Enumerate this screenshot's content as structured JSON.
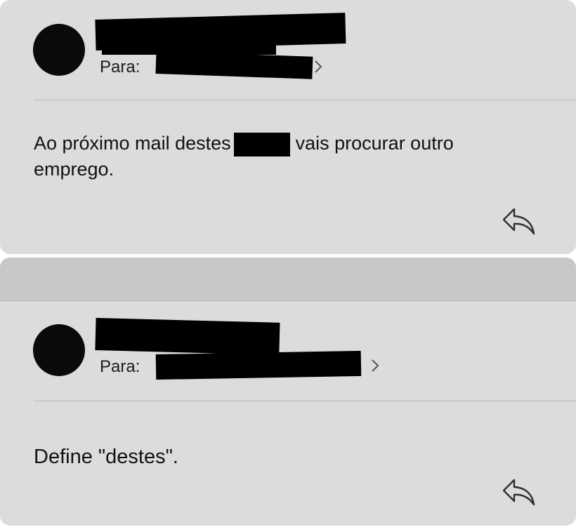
{
  "messages": [
    {
      "to_label": "Para:",
      "body_before": "Ao próximo mail destes",
      "body_after": "vais procurar outro",
      "body_line2": "emprego."
    },
    {
      "to_label": "Para:",
      "body": "Define \"destes\"."
    }
  ],
  "icons": {
    "avatar": "avatar",
    "chevron": "chevron-right-icon",
    "reply": "reply-icon"
  },
  "colors": {
    "card_background": "#dcdcdc",
    "separator_bar": "#c8c8c8",
    "redaction": "#000000"
  }
}
